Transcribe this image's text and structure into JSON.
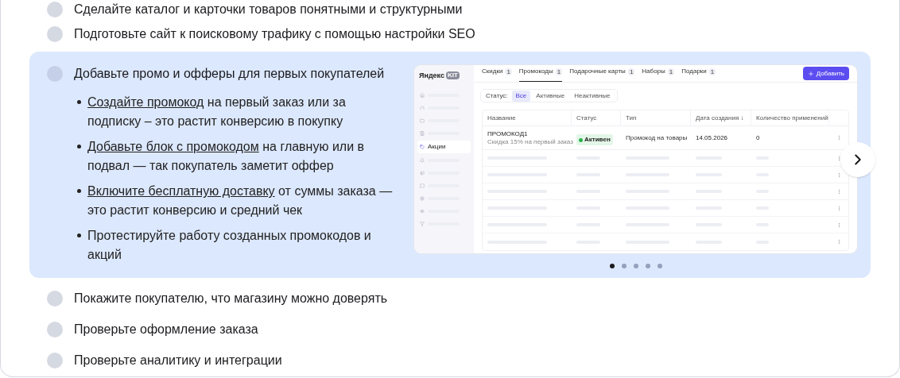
{
  "steps": [
    {
      "title": "Сделайте каталог и карточки товаров понятными и структурными",
      "expanded": false
    },
    {
      "title": "Подготовьте сайт к поисковому трафику с помощью настройки SEO",
      "expanded": false
    },
    {
      "title": "Добавьте промо и офферы для первых покупателей",
      "expanded": true,
      "bullets": [
        {
          "link": "Создайте промокод",
          "text": " на первый заказ или за подписку – это растит конверсию в покупку"
        },
        {
          "link": "Добавьте блок с промокодом",
          "text": " на главную или в подвал — так покупатель заметит оффер"
        },
        {
          "link": "Включите бесплатную доставку",
          "text": " от суммы заказа — это растит конверсию и средний чек"
        },
        {
          "text": "Протестируйте работу созданных промокодов и акций"
        }
      ],
      "preview": {
        "logo": "Яндекс",
        "logo_badge": "KIT",
        "tabs": [
          {
            "label": "Скидки",
            "count": "1",
            "selected": false
          },
          {
            "label": "Промокоды",
            "count": "1",
            "selected": true
          },
          {
            "label": "Подарочные карты",
            "count": "1",
            "selected": false
          },
          {
            "label": "Наборы",
            "count": "1",
            "selected": false
          },
          {
            "label": "Подарки",
            "count": "1",
            "selected": false
          }
        ],
        "add_button": "Добавить",
        "filter_label": "Статус:",
        "filters": [
          {
            "label": "Все",
            "selected": true
          },
          {
            "label": "Активные",
            "selected": false
          },
          {
            "label": "Неактивные",
            "selected": false
          }
        ],
        "sidebar_active": "Акции",
        "columns": [
          "Название",
          "Статус",
          "Тип",
          "Дата создания ↓",
          "Количество применений"
        ],
        "row": {
          "name": "ПРОМОКОД1",
          "note": "Скидка 15% на первый заказ",
          "status": "Активен",
          "type": "Промокод на товары",
          "date": "14.05.2026",
          "uses": "0"
        }
      },
      "pages": [
        {
          "selected": true
        },
        {
          "selected": false
        },
        {
          "selected": false
        },
        {
          "selected": false
        },
        {
          "selected": false
        }
      ]
    },
    {
      "title": "Покажите покупателю, что магазину можно доверять",
      "expanded": false
    },
    {
      "title": "Проверьте оформление заказа",
      "expanded": false
    },
    {
      "title": "Проверьте аналитику и интеграции",
      "expanded": false
    }
  ]
}
